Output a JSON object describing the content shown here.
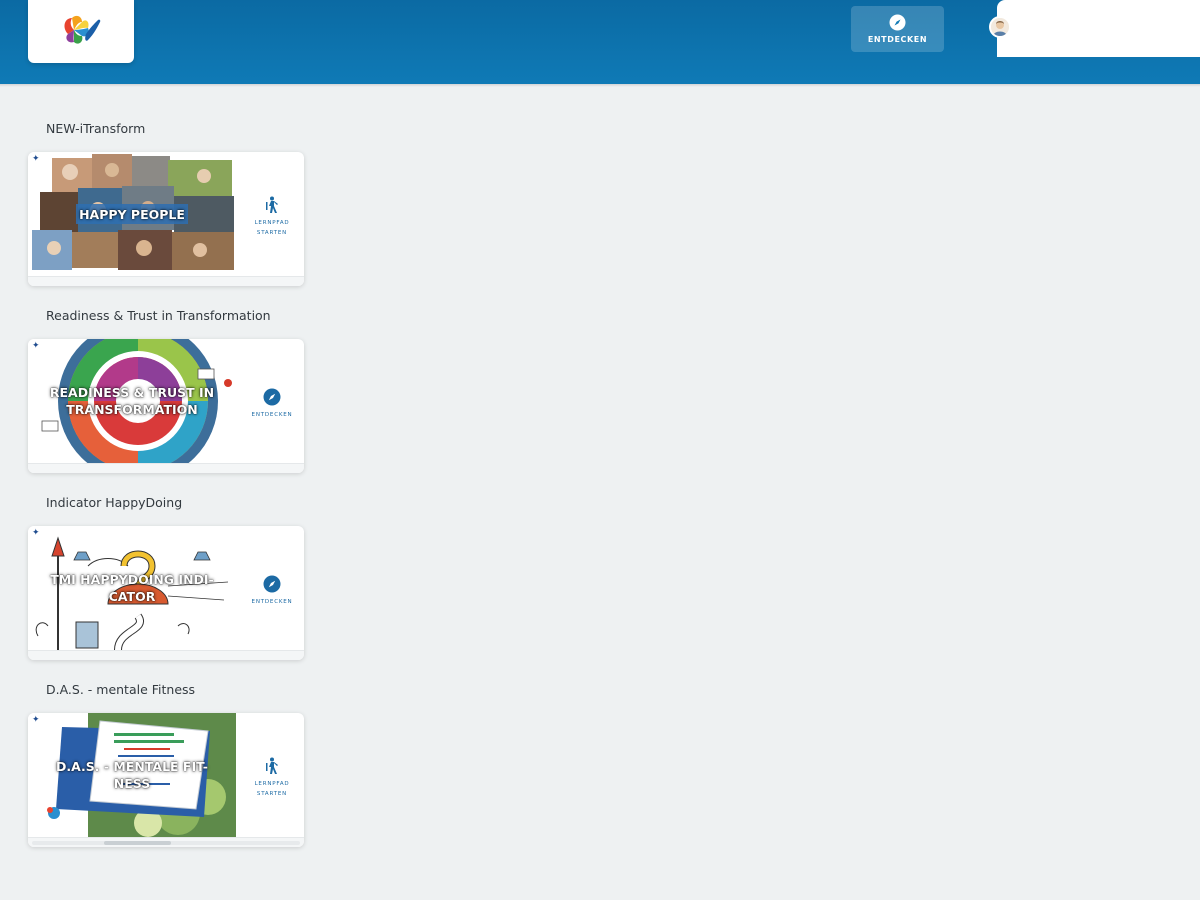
{
  "header": {
    "discover_label": "ENTDECKEN",
    "background": "#0b6aa3"
  },
  "sections": [
    {
      "title": "NEW-iTransform",
      "card_title": "HAPPY PEOPLE",
      "action_label": "LERNPFAD STARTEN",
      "action_icon": "walking-person-icon"
    },
    {
      "title": "Readiness & Trust in Transformation",
      "card_title": "READINESS & TRUST IN TRANSFORMATION",
      "action_label": "ENTDECKEN",
      "action_icon": "compass-icon"
    },
    {
      "title": "Indicator HappyDoing",
      "card_title": "TMI HAPPYDOING INDI-CATOR",
      "action_label": "ENTDECKEN",
      "action_icon": "compass-icon"
    },
    {
      "title": "D.A.S. - mentale Fitness",
      "card_title": "D.A.S. - MENTALE FIT-NESS",
      "action_label": "LERNPFAD STARTEN",
      "action_icon": "walking-person-icon",
      "progress": 0.25
    }
  ],
  "colors": {
    "accent": "#1c6aa4",
    "background": "#eef1f2"
  }
}
